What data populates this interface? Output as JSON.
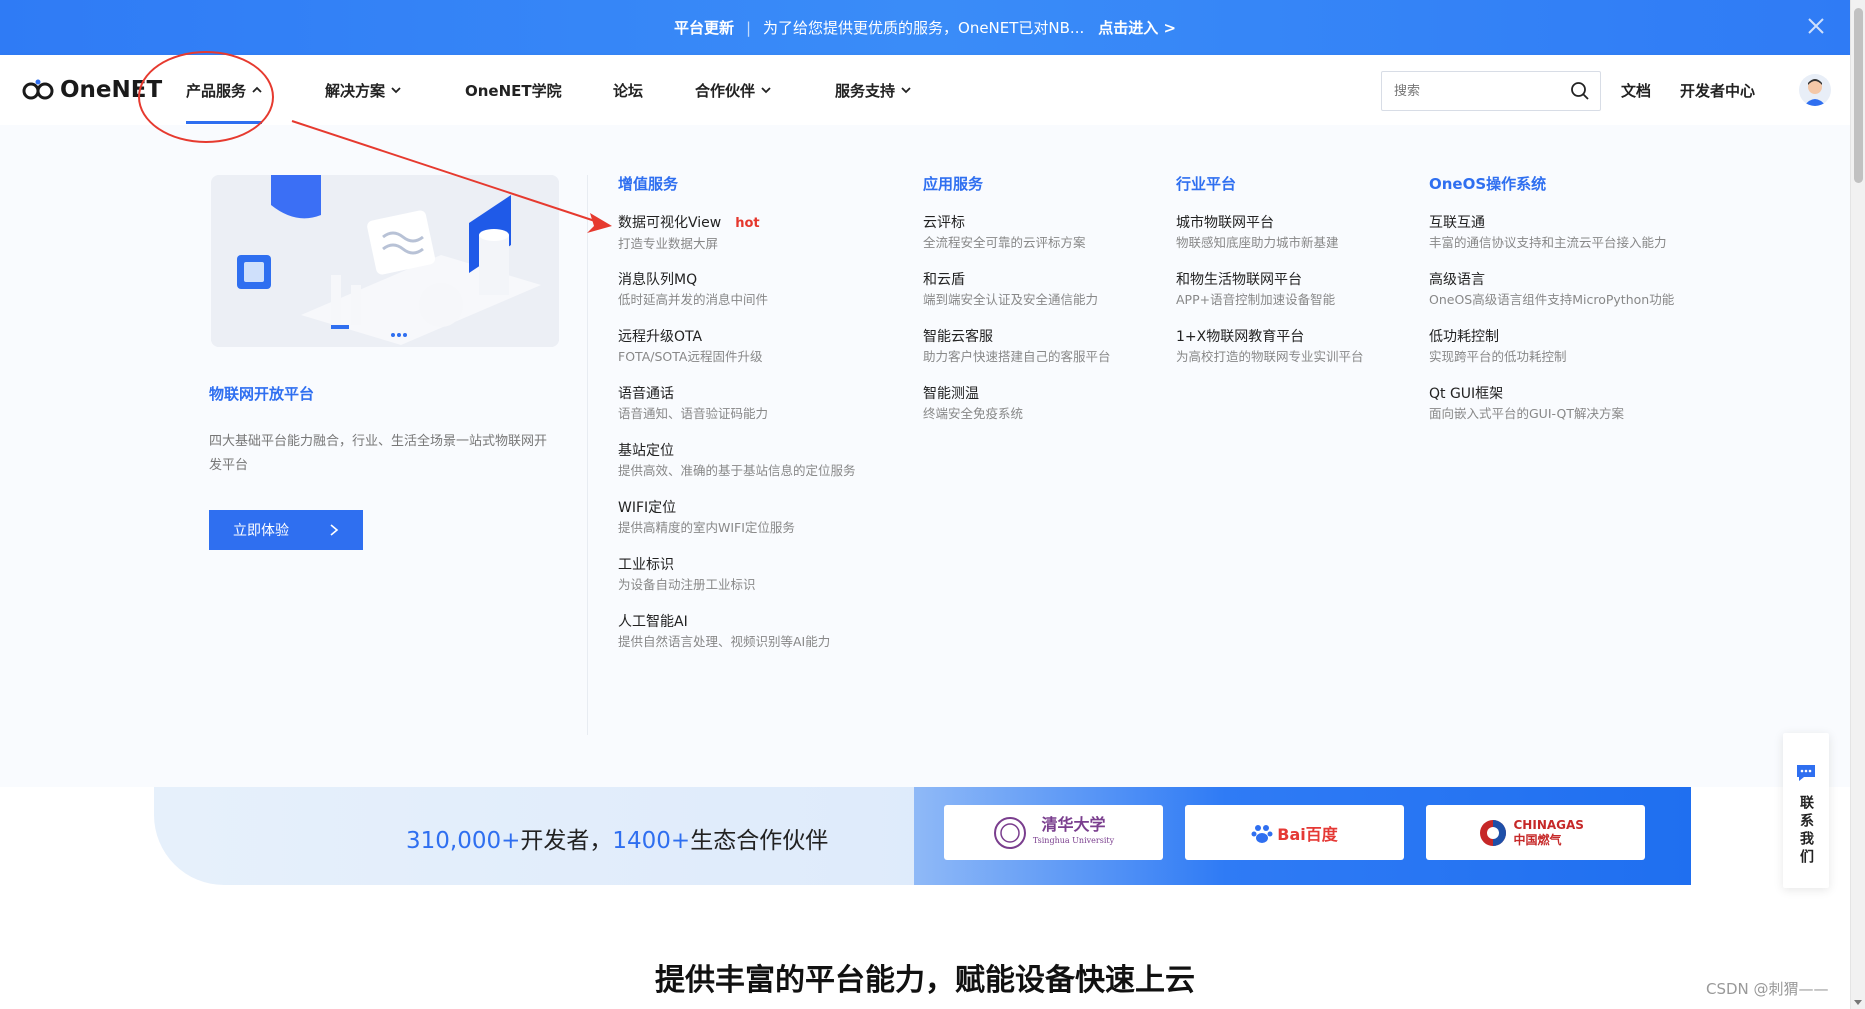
{
  "banner": {
    "tag": "平台更新",
    "separator": "|",
    "message": "为了给您提供更优质的服务，OneNET已对NB...",
    "cta": "点击进入 >"
  },
  "nav": {
    "logo": "OneNET",
    "items": [
      {
        "label": "产品服务",
        "active": true
      },
      {
        "label": "解决方案"
      },
      {
        "label": "OneNET学院"
      },
      {
        "label": "论坛"
      },
      {
        "label": "合作伙伴"
      },
      {
        "label": "服务支持"
      }
    ],
    "search_placeholder": "搜索",
    "docs": "文档",
    "dev_center": "开发者中心"
  },
  "panel": {
    "left": {
      "title": "物联网开放平台",
      "desc": "四大基础平台能力融合，行业、生活全场景一站式物联网开发平台",
      "button": "立即体验"
    },
    "columns": [
      {
        "title": "增值服务",
        "items": [
          {
            "name": "数据可视化View",
            "badge": "hot",
            "desc": "打造专业数据大屏"
          },
          {
            "name": "消息队列MQ",
            "desc": "低时延高并发的消息中间件"
          },
          {
            "name": "远程升级OTA",
            "desc": "FOTA/SOTA远程固件升级"
          },
          {
            "name": "语音通话",
            "desc": "语音通知、语音验证码能力"
          },
          {
            "name": "基站定位",
            "desc": "提供高效、准确的基于基站信息的定位服务"
          },
          {
            "name": "WIFI定位",
            "desc": "提供高精度的室内WIFI定位服务"
          },
          {
            "name": "工业标识",
            "desc": "为设备自动注册工业标识"
          },
          {
            "name": "人工智能AI",
            "desc": "提供自然语言处理、视频识别等AI能力"
          }
        ]
      },
      {
        "title": "应用服务",
        "items": [
          {
            "name": "云评标",
            "desc": "全流程安全可靠的云评标方案"
          },
          {
            "name": "和云盾",
            "desc": "端到端安全认证及安全通信能力"
          },
          {
            "name": "智能云客服",
            "desc": "助力客户快速搭建自己的客服平台"
          },
          {
            "name": "智能测温",
            "desc": "终端安全免疫系统"
          }
        ]
      },
      {
        "title": "行业平台",
        "items": [
          {
            "name": "城市物联网平台",
            "desc": "物联感知底座助力城市新基建"
          },
          {
            "name": "和物生活物联网平台",
            "desc": "APP+语音控制加速设备智能"
          },
          {
            "name": "1+X物联网教育平台",
            "desc": "为高校打造的物联网专业实训平台"
          }
        ]
      },
      {
        "title": "OneOS操作系统",
        "items": [
          {
            "name": "互联互通",
            "desc": "丰富的通信协议支持和主流云平台接入能力"
          },
          {
            "name": "高级语言",
            "desc": "OneOS高级语言组件支持MicroPython功能"
          },
          {
            "name": "低功耗控制",
            "desc": "实现跨平台的低功耗控制"
          },
          {
            "name": "Qt GUI框架",
            "desc": "面向嵌入式平台的GUI-QT解决方案"
          }
        ]
      }
    ]
  },
  "stats": {
    "developers_num": "310,000+",
    "developers_label": "开发者，",
    "partners_num": "1400+",
    "partners_label": "生态合作伙伴",
    "partner_logos": [
      {
        "name": "清华大学",
        "sub": "Tsinghua University",
        "color": "#7a3e8e"
      },
      {
        "name": "Bai百度",
        "color": "#e53935"
      },
      {
        "name": "CHINAGAS 中国燃气",
        "color": "#c62828"
      }
    ]
  },
  "headline": "提供丰富的平台能力，赋能设备快速上云",
  "contact": "联系我们",
  "watermark": "CSDN @刺猬——",
  "colors": {
    "brand": "#2f6ff0",
    "hot": "#e5372d",
    "annotation": "#e63a2f"
  }
}
